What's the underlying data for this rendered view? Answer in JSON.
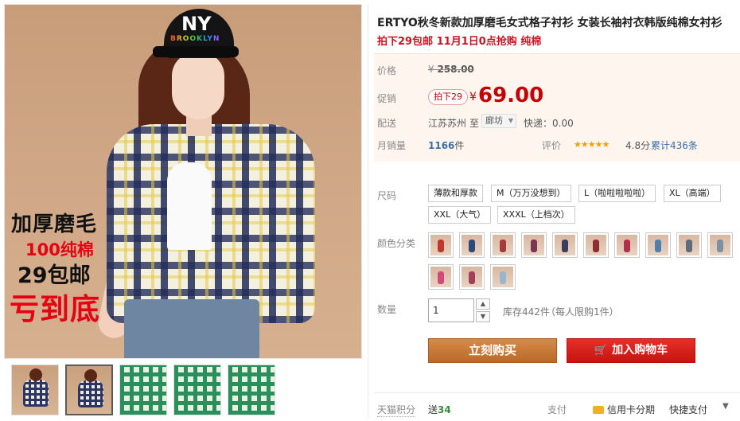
{
  "gallery": {
    "promo_lines": [
      "加厚磨毛",
      "100纯棉",
      "29包邮",
      "亏到底"
    ],
    "cap_text": "NY",
    "cap_subtext": "BROOKLYN",
    "thumbnails": [
      {
        "style": "plaid",
        "active": false
      },
      {
        "style": "plaid",
        "active": true
      },
      {
        "style": "green",
        "active": false
      },
      {
        "style": "green",
        "active": false
      },
      {
        "style": "green",
        "active": false
      }
    ]
  },
  "product": {
    "title": "ERTYO秋冬新款加厚磨毛女式格子衬衫 女装长袖衬衣韩版纯棉女衬衫",
    "subtitle": "拍下29包邮 11月1日0点抢购 纯棉"
  },
  "price": {
    "label": "价格",
    "original_symbol": "¥",
    "original_value": "258.00",
    "promo_label": "促销",
    "promo_tag": "拍下29",
    "currency": "¥",
    "current_value": "69.00"
  },
  "delivery": {
    "label": "配送",
    "from": "江苏苏州",
    "to_prefix": "至",
    "to_city": "廊坊",
    "shipping": "快递：0.00"
  },
  "sales": {
    "label": "月销量",
    "count": "1166",
    "unit": "件",
    "rating_label": "评价",
    "stars": "★★★★★",
    "score": "4.8分",
    "reviews": "累计436条"
  },
  "size": {
    "label": "尺码",
    "options": [
      "薄款和厚款",
      "M（万万没想到）",
      "L（啦啦啦啦啦）",
      "XL（高端）",
      "XXL（大气）",
      "XXXL（上档次）"
    ]
  },
  "color": {
    "label": "颜色分类",
    "swatch_colors": [
      "#c0392b",
      "#2e4a7d",
      "#a83a3a",
      "#7a3550",
      "#3c3c5c",
      "#8d2f2f",
      "#b0304a",
      "#4f7fae",
      "#5c6c7a",
      "#7d8fa3",
      "#d14a7a",
      "#a44055",
      "#9ab6cc"
    ]
  },
  "quantity": {
    "label": "数量",
    "value": "1",
    "stock": "库存442件",
    "limit": "（每人限购1件）",
    "up": "▲",
    "down": "▼"
  },
  "actions": {
    "buy_now": "立刻购买",
    "add_to_cart": "加入购物车",
    "cart_icon": "cart-icon"
  },
  "footer": {
    "points_label": "天猫积分",
    "points_prefix": "送",
    "points_value": "34",
    "pay_label": "支付",
    "pay_card": "信用卡分期",
    "pay_fast": "快捷支付",
    "pay_more": "▼"
  }
}
